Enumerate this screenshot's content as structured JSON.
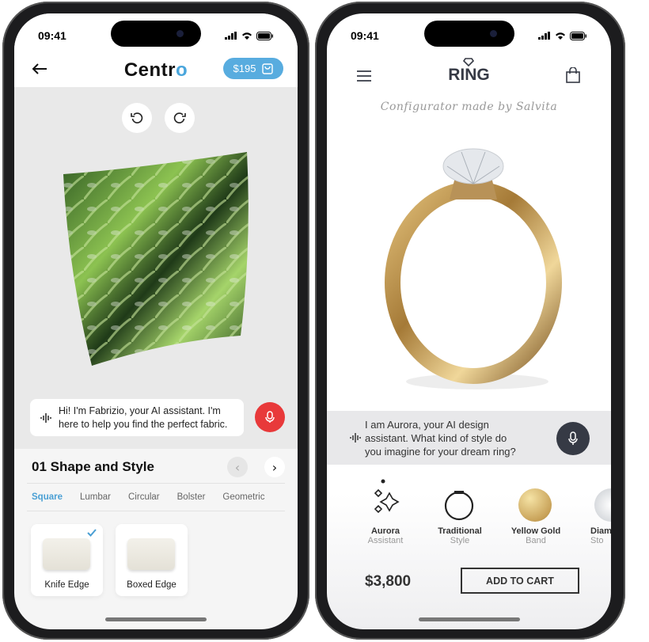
{
  "left_phone": {
    "status": {
      "time": "09:41"
    },
    "header": {
      "logo_main": "Centr",
      "logo_accent": "o",
      "cart_price": "$195"
    },
    "assistant": {
      "line1": "Hi! I'm Fabrizio, your AI assistant. I'm",
      "line2": "here to help you find the perfect fabric."
    },
    "section": {
      "title": "01 Shape and Style"
    },
    "tabs": [
      {
        "label": "Square",
        "active": true
      },
      {
        "label": "Lumbar"
      },
      {
        "label": "Circular"
      },
      {
        "label": "Bolster"
      },
      {
        "label": "Geometric"
      }
    ],
    "cards": [
      {
        "label": "Knife Edge",
        "selected": true
      },
      {
        "label": "Boxed Edge"
      }
    ],
    "colors": {
      "accent": "#58acdf",
      "mic": "#e8393a"
    }
  },
  "right_phone": {
    "status": {
      "time": "09:41"
    },
    "header": {
      "logo": "RING",
      "tagline": "Configurator made by Salvita"
    },
    "assistant": {
      "line1": "I am Aurora, your AI design",
      "line2": "assistant. What kind of style do",
      "line3": "you imagine for your dream ring?"
    },
    "options": [
      {
        "title": "Aurora",
        "subtitle": "Assistant",
        "icon": "sparkles-icon"
      },
      {
        "title": "Traditional",
        "subtitle": "Style",
        "icon": "ring-outline-icon"
      },
      {
        "title": "Yellow Gold",
        "subtitle": "Band",
        "icon": "gold-swatch"
      },
      {
        "title": "Diam",
        "subtitle": "Sto",
        "icon": "diamond-swatch"
      }
    ],
    "price": "$3,800",
    "add_to_cart": "ADD TO CART",
    "colors": {
      "dark": "#363a45",
      "gold": "#c9a35a"
    }
  }
}
